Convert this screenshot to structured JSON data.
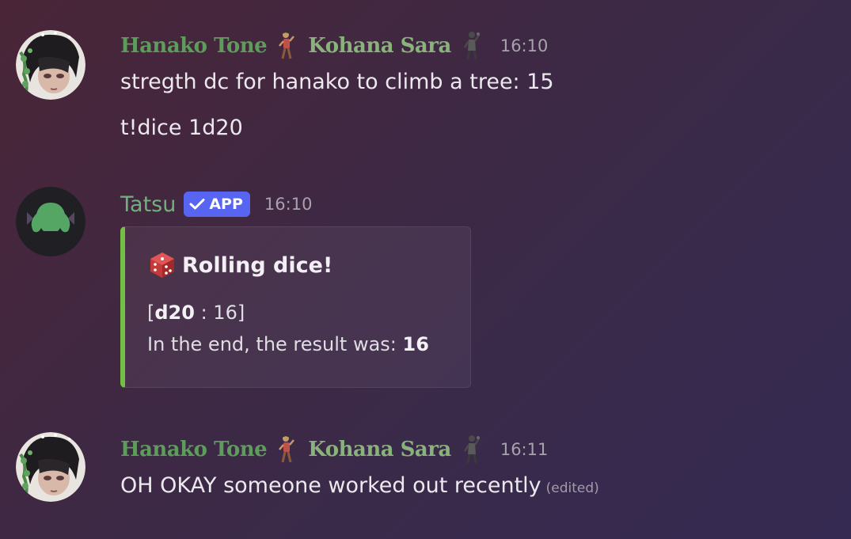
{
  "messages": [
    {
      "author_primary": "Hanako Tone",
      "author_secondary": "Kohana Sara",
      "timestamp": "16:10",
      "lines": [
        "stregth dc for hanako to climb a tree: 15",
        "t!dice 1d20"
      ]
    },
    {
      "author": "Tatsu",
      "badge": "APP",
      "timestamp": "16:10",
      "embed": {
        "title": "Rolling dice!",
        "roll_open": "[",
        "roll_die": "d20",
        "roll_sep": " : 16]",
        "result_label": "In the end, the result was: ",
        "result_value": "16",
        "accent_color": "#74c044"
      }
    },
    {
      "author_primary": "Hanako Tone",
      "author_secondary": "Kohana Sara",
      "timestamp": "16:11",
      "lines": [
        "OH OKAY someone worked out recently"
      ],
      "edited_label": "(edited)"
    }
  ],
  "colors": {
    "name_green": "#5e9c5c",
    "bot_green": "#71b07c",
    "badge_blurple": "#5865f2"
  },
  "icons": [
    "dice-icon",
    "checkmark-icon",
    "dancing-figure-icon"
  ]
}
